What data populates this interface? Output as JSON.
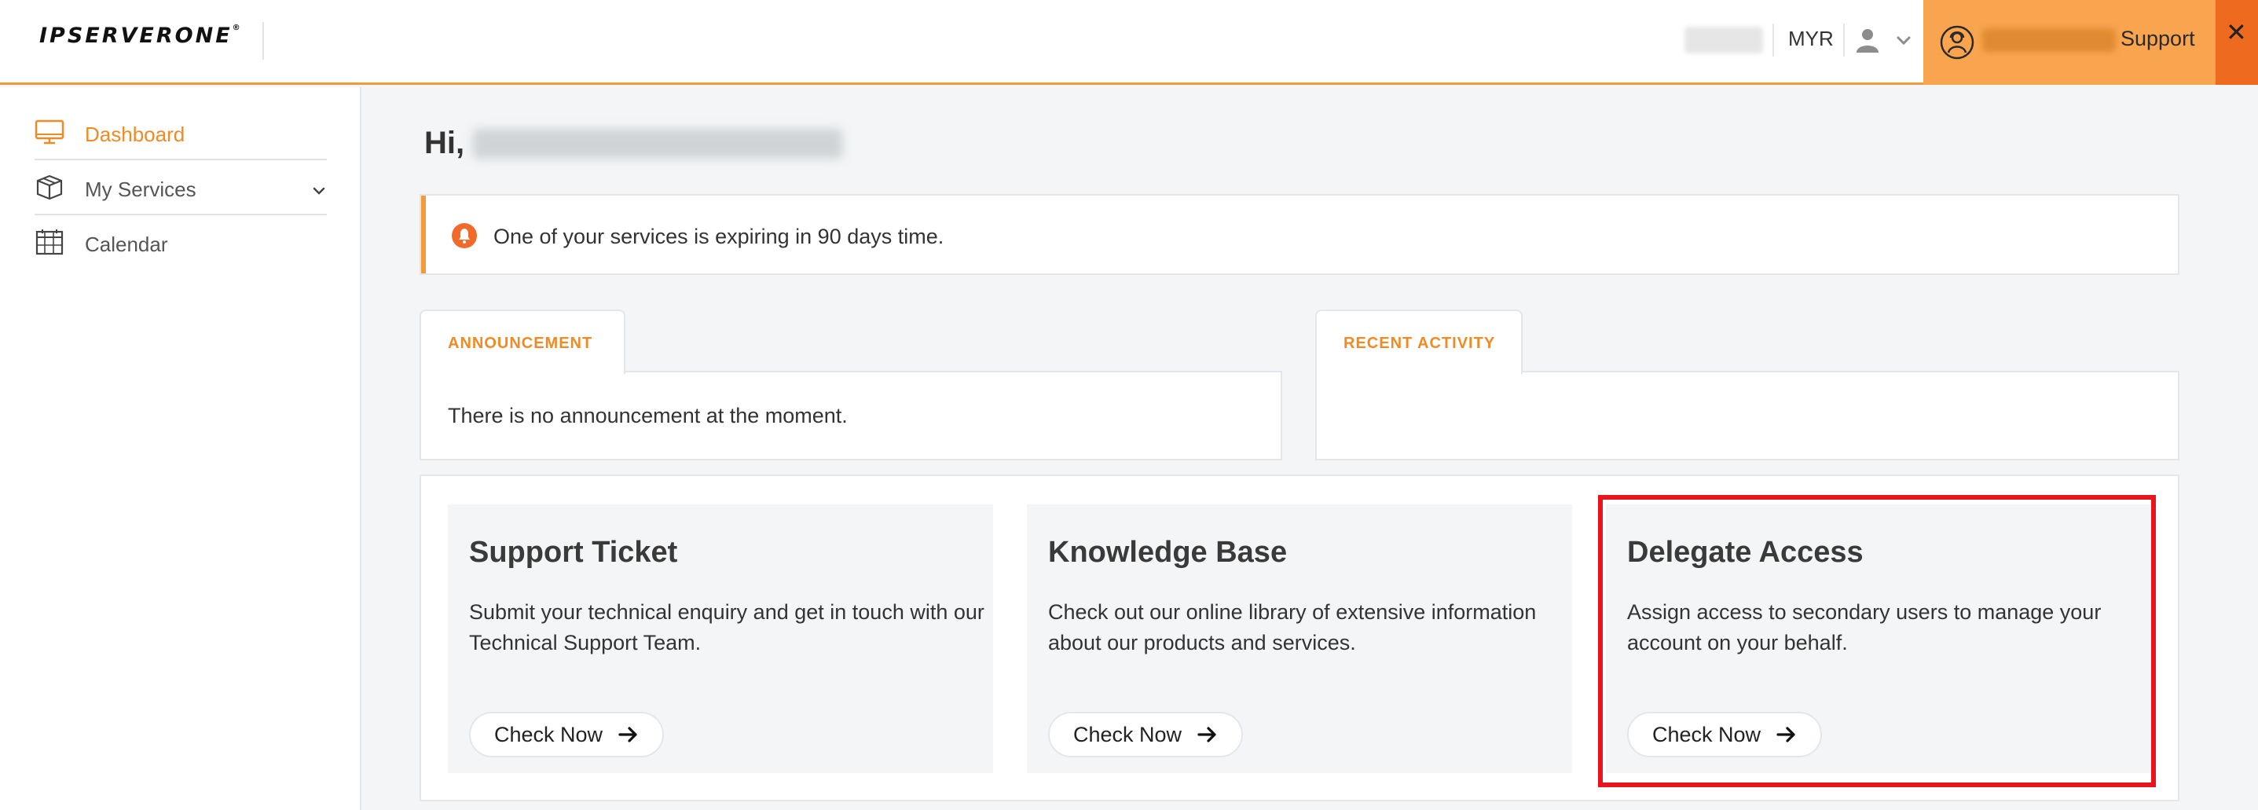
{
  "header": {
    "logo_text": "IPSERVERONE",
    "logo_mark": "®",
    "currency": "MYR",
    "support_label": "Support",
    "close_glyph": "✕"
  },
  "sidebar": {
    "items": [
      {
        "label": "Dashboard",
        "icon": "monitor-icon",
        "active": true
      },
      {
        "label": "My Services",
        "icon": "box-icon",
        "active": false
      },
      {
        "label": "Calendar",
        "icon": "calendar-icon",
        "active": false
      }
    ]
  },
  "main": {
    "greeting": "Hi,",
    "alert_text": "One of your services is expiring in 90 days time.",
    "announcement": {
      "tab_label": "ANNOUNCEMENT",
      "body": "There is no announcement at the moment."
    },
    "recent_activity": {
      "tab_label": "RECENT ACTIVITY",
      "body": ""
    },
    "cards": [
      {
        "title": "Support Ticket",
        "description": "Submit your technical enquiry and get in touch with our Technical Support Team.",
        "button": "Check Now"
      },
      {
        "title": "Knowledge Base",
        "description": "Check out our online library of extensive information about our products and services.",
        "button": "Check Now"
      },
      {
        "title": "Delegate Access",
        "description": "Assign access to secondary users to manage your account on your behalf.",
        "button": "Check Now"
      }
    ]
  },
  "colors": {
    "accent": "#f39a3c",
    "support_bg": "#f9a550",
    "close_bg": "#ee6a1f",
    "highlight": "#e8141e"
  }
}
